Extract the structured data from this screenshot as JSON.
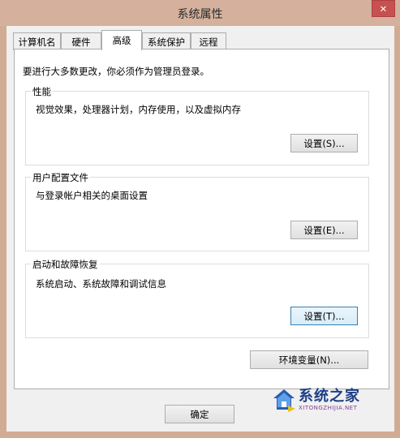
{
  "window": {
    "title": "系统属性",
    "close_glyph": "✕"
  },
  "tabs": [
    {
      "label": "计算机名",
      "active": false
    },
    {
      "label": "硬件",
      "active": false
    },
    {
      "label": "高级",
      "active": true
    },
    {
      "label": "系统保护",
      "active": false
    },
    {
      "label": "远程",
      "active": false
    }
  ],
  "panel": {
    "info_text": "要进行大多数更改，你必须作为管理员登录。",
    "groups": {
      "performance": {
        "label": "性能",
        "description": "视觉效果，处理器计划，内存使用，以及虚拟内存",
        "button": "设置(S)..."
      },
      "user_profiles": {
        "label": "用户配置文件",
        "description": "与登录帐户相关的桌面设置",
        "button": "设置(E)..."
      },
      "startup_recovery": {
        "label": "启动和故障恢复",
        "description": "系统启动、系统故障和调试信息",
        "button": "设置(T)..."
      }
    },
    "env_button": "环境变量(N)..."
  },
  "footer": {
    "ok_button": "确定"
  },
  "watermark": {
    "brand": "系统之家",
    "url": "XITONGZHIJIA.NET"
  }
}
